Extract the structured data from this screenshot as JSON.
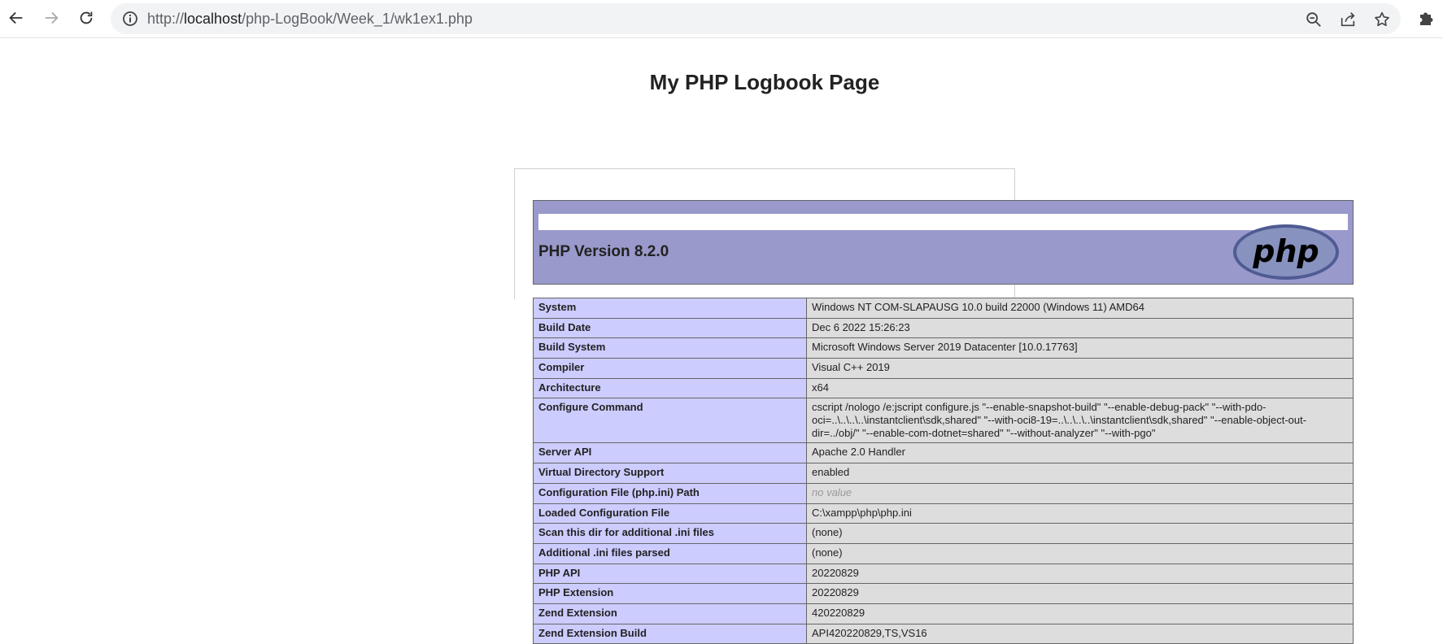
{
  "browser": {
    "url_prefix": "http://",
    "url_host": "localhost",
    "url_path": "/php-LogBook/Week_1/wk1ex1.php"
  },
  "page": {
    "title": "My PHP Logbook Page"
  },
  "phpinfo": {
    "version": "PHP Version 8.2.0",
    "logo_text": "php",
    "rows": [
      {
        "key": "System",
        "value": "Windows NT COM-SLAPAUSG 10.0 build 22000 (Windows 11) AMD64"
      },
      {
        "key": "Build Date",
        "value": "Dec 6 2022 15:26:23"
      },
      {
        "key": "Build System",
        "value": "Microsoft Windows Server 2019 Datacenter [10.0.17763]"
      },
      {
        "key": "Compiler",
        "value": "Visual C++ 2019"
      },
      {
        "key": "Architecture",
        "value": "x64"
      },
      {
        "key": "Configure Command",
        "value": "cscript /nologo /e:jscript configure.js \"--enable-snapshot-build\" \"--enable-debug-pack\" \"--with-pdo-oci=..\\..\\..\\..\\instantclient\\sdk,shared\" \"--with-oci8-19=..\\..\\..\\..\\instantclient\\sdk,shared\" \"--enable-object-out-dir=../obj/\" \"--enable-com-dotnet=shared\" \"--without-analyzer\" \"--with-pgo\""
      },
      {
        "key": "Server API",
        "value": "Apache 2.0 Handler"
      },
      {
        "key": "Virtual Directory Support",
        "value": "enabled"
      },
      {
        "key": "Configuration File (php.ini) Path",
        "value": "no value"
      },
      {
        "key": "Loaded Configuration File",
        "value": "C:\\xampp\\php\\php.ini"
      },
      {
        "key": "Scan this dir for additional .ini files",
        "value": "(none)"
      },
      {
        "key": "Additional .ini files parsed",
        "value": "(none)"
      },
      {
        "key": "PHP API",
        "value": "20220829"
      },
      {
        "key": "PHP Extension",
        "value": "20220829"
      },
      {
        "key": "Zend Extension",
        "value": "420220829"
      },
      {
        "key": "Zend Extension Build",
        "value": "API420220829,TS,VS16"
      }
    ]
  },
  "icons": {
    "back": "back-arrow-icon",
    "forward": "forward-arrow-icon",
    "reload": "reload-icon",
    "info": "info-icon",
    "zoom": "zoom-out-icon",
    "share": "share-icon",
    "bookmark": "star-icon",
    "extensions": "puzzle-icon"
  },
  "colors": {
    "header": "#9999cc",
    "key_cell": "#ccccff",
    "value_cell": "#dddddd",
    "no_value": "#999999",
    "border": "#666666"
  }
}
